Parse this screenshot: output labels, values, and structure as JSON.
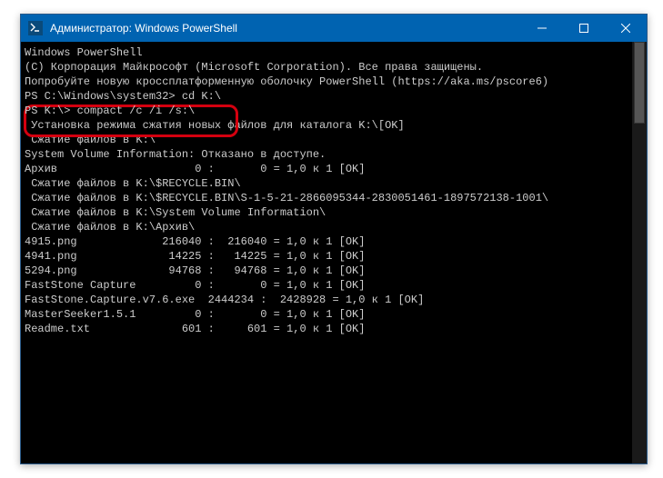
{
  "titlebar": {
    "title": "Администратор: Windows PowerShell"
  },
  "terminal": {
    "lines": [
      "Windows PowerShell",
      "(C) Корпорация Майкрософт (Microsoft Corporation). Все права защищены.",
      "",
      "Попробуйте новую кроссплатформенную оболочку PowerShell (https://aka.ms/pscore6)",
      ""
    ],
    "cmd1_prompt": "PS C:\\Windows\\system32>",
    "cmd1_input": " cd K:\\",
    "cmd2_prompt": "PS K:\\>",
    "cmd2_input": " compact /c /i /s:\\",
    "output": [
      "",
      " Установка режима сжатия новых файлов для каталога K:\\[OK]",
      "",
      " Сжатие файлов в K:\\",
      "",
      "System Volume Information: Отказано в доступе.",
      "Архив                     0 :       0 = 1,0 к 1 [OK]",
      "",
      " Сжатие файлов в K:\\$RECYCLE.BIN\\",
      "",
      "",
      " Сжатие файлов в K:\\$RECYCLE.BIN\\S-1-5-21-2866095344-2830051461-1897572138-1001\\",
      "",
      "",
      " Сжатие файлов в K:\\System Volume Information\\",
      "",
      "",
      " Сжатие файлов в K:\\Архив\\",
      "",
      "4915.png             216040 :  216040 = 1,0 к 1 [OK]",
      "4941.png              14225 :   14225 = 1,0 к 1 [OK]",
      "5294.png              94768 :   94768 = 1,0 к 1 [OK]",
      "FastStone Capture         0 :       0 = 1,0 к 1 [OK]",
      "FastStone.Capture.v7.6.exe  2444234 :  2428928 = 1,0 к 1 [OK]",
      "MasterSeeker1.5.1         0 :       0 = 1,0 к 1 [OK]",
      "Readme.txt              601 :     601 = 1,0 к 1 [OK]"
    ]
  }
}
